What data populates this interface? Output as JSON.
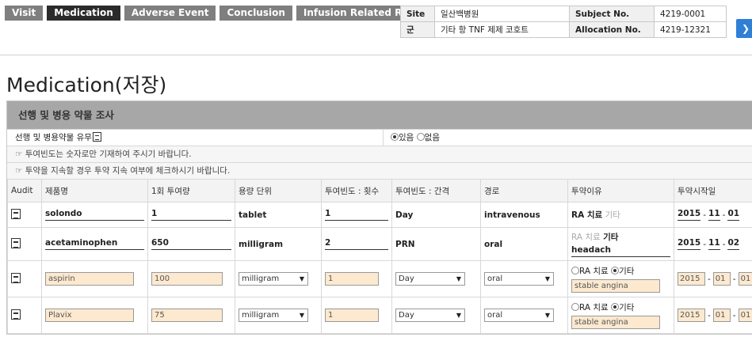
{
  "tabs": [
    "Visit",
    "Medication",
    "Adverse Event",
    "Conclusion",
    "Infusion Related Reaction"
  ],
  "info": {
    "site_label": "Site",
    "site_value": "일산백병원",
    "subject_label": "Subject No.",
    "subject_value": "4219-0001",
    "group_label": "군",
    "group_value": "기타 항 TNF 제제 코호트",
    "allocation_label": "Allocation No.",
    "allocation_value": "4219-12321"
  },
  "page_title": "Medication(저장)",
  "panel": {
    "title": "선행 및 병용 약물 조사",
    "question": "선행 및 병용약물 유무",
    "yes_label": "있음",
    "no_label": "없음",
    "note1": "☞ 투여빈도는 숫자로만 기재하여 주시기 바랍니다.",
    "note2": "☞ 투약을 지속할 경우 투약 지속 여부에 체크하시기 바랍니다."
  },
  "columns": [
    "Audit",
    "제품명",
    "1회 투여량",
    "용량 단위",
    "투여빈도 : 횟수",
    "투여빈도 : 간격",
    "경로",
    "투약이유",
    "투약시작일"
  ],
  "reason_labels": {
    "ra": "RA 치료",
    "other": "기타"
  },
  "rows": [
    {
      "product": "solondo",
      "dose": "1",
      "unit": "tablet",
      "freq": "1",
      "interval": "Day",
      "route": "intravenous",
      "reason_other_text": "",
      "start_year": "2015",
      "start_month": "11",
      "start_day": "01"
    },
    {
      "product": "acetaminophen",
      "dose": "650",
      "unit": "milligram",
      "freq": "2",
      "interval": "PRN",
      "route": "oral",
      "reason_other_text": "headach",
      "start_year": "2015",
      "start_month": "11",
      "start_day": "02"
    },
    {
      "product": "aspirin",
      "dose": "100",
      "unit": "milligram",
      "freq": "1",
      "interval": "Day",
      "route": "oral",
      "reason_other_text": "stable angina",
      "start_year": "2015",
      "start_month": "01",
      "start_day": "01"
    },
    {
      "product": "Plavix",
      "dose": "75",
      "unit": "milligram",
      "freq": "1",
      "interval": "Day",
      "route": "oral",
      "reason_other_text": "stable angina",
      "start_year": "2015",
      "start_month": "01",
      "start_day": "01"
    }
  ]
}
